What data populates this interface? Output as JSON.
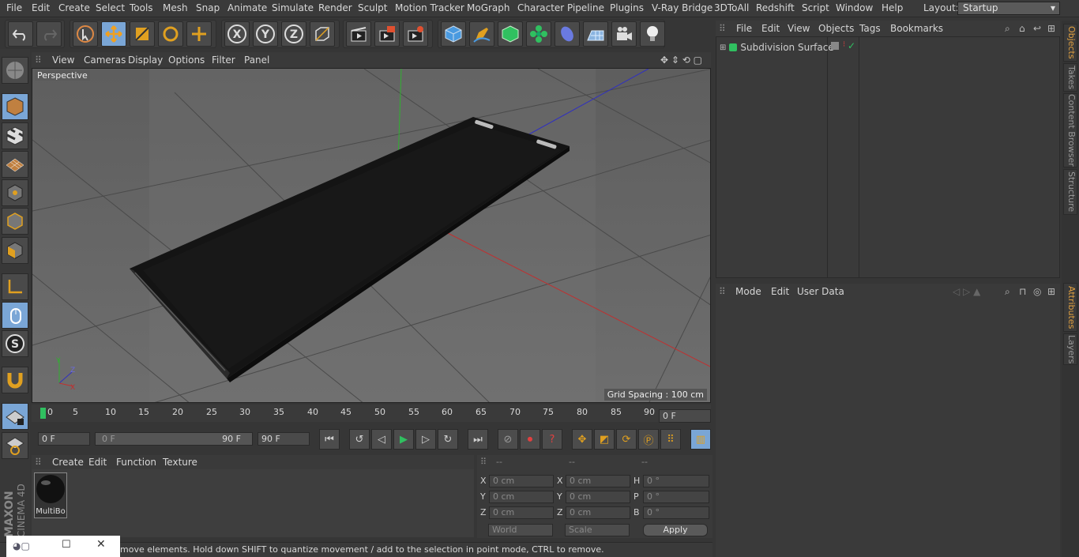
{
  "menubar": {
    "items": [
      "File",
      "Edit",
      "Create",
      "Select",
      "Tools",
      "Mesh",
      "Snap",
      "Animate",
      "Simulate",
      "Render",
      "Sculpt",
      "Motion Tracker",
      "MoGraph",
      "Character",
      "Pipeline",
      "Plugins",
      "V-Ray Bridge",
      "3DToAll",
      "Redshift",
      "Script",
      "Window",
      "Help"
    ],
    "layout_label": "Layout:",
    "layout_value": "Startup"
  },
  "viewport": {
    "menu": [
      "View",
      "Cameras",
      "Display",
      "Options",
      "Filter",
      "Panel"
    ],
    "camera_label": "Perspective",
    "grid_spacing": "Grid Spacing : 100 cm"
  },
  "timeline": {
    "ticks": [
      "0",
      "5",
      "10",
      "15",
      "20",
      "25",
      "30",
      "35",
      "40",
      "45",
      "50",
      "55",
      "60",
      "65",
      "70",
      "75",
      "80",
      "85",
      "90"
    ],
    "current_frame": "0 F",
    "start_frame": "0 F",
    "range_start": "0 F",
    "range_end": "90 F",
    "end_frame": "90 F"
  },
  "materials": {
    "menu": [
      "Create",
      "Edit",
      "Function",
      "Texture"
    ],
    "items": [
      {
        "name": "MultiBo"
      }
    ]
  },
  "coordinates": {
    "headers": [
      "--",
      "--",
      "--"
    ],
    "rows": [
      {
        "a_label": "X",
        "a_val": "0 cm",
        "b_label": "X",
        "b_val": "0 cm",
        "c_label": "H",
        "c_val": "0 °"
      },
      {
        "a_label": "Y",
        "a_val": "0 cm",
        "b_label": "Y",
        "b_val": "0 cm",
        "c_label": "P",
        "c_val": "0 °"
      },
      {
        "a_label": "Z",
        "a_val": "0 cm",
        "b_label": "Z",
        "b_val": "0 cm",
        "c_label": "B",
        "c_val": "0 °"
      }
    ],
    "space": "World",
    "mode": "Scale",
    "apply": "Apply"
  },
  "status": {
    "text": "move elements. Hold down SHIFT to quantize movement / add to the selection in point mode, CTRL to remove."
  },
  "objects": {
    "menu": [
      "File",
      "Edit",
      "View",
      "Objects",
      "Tags",
      "Bookmarks"
    ],
    "tree": [
      {
        "name": "Subdivision Surface"
      }
    ]
  },
  "attributes": {
    "menu": [
      "Mode",
      "Edit",
      "User Data"
    ]
  },
  "right_tabs": [
    "Objects",
    "Takes",
    "Content Browser",
    "Structure",
    "Attributes",
    "Layers"
  ],
  "brand": {
    "maxon": "MAXON",
    "product": "CINEMA 4D"
  },
  "colors": {
    "accent": "#7aa6d6",
    "axis_x": "#c03030",
    "axis_y": "#30b030",
    "axis_z": "#3030c0"
  }
}
